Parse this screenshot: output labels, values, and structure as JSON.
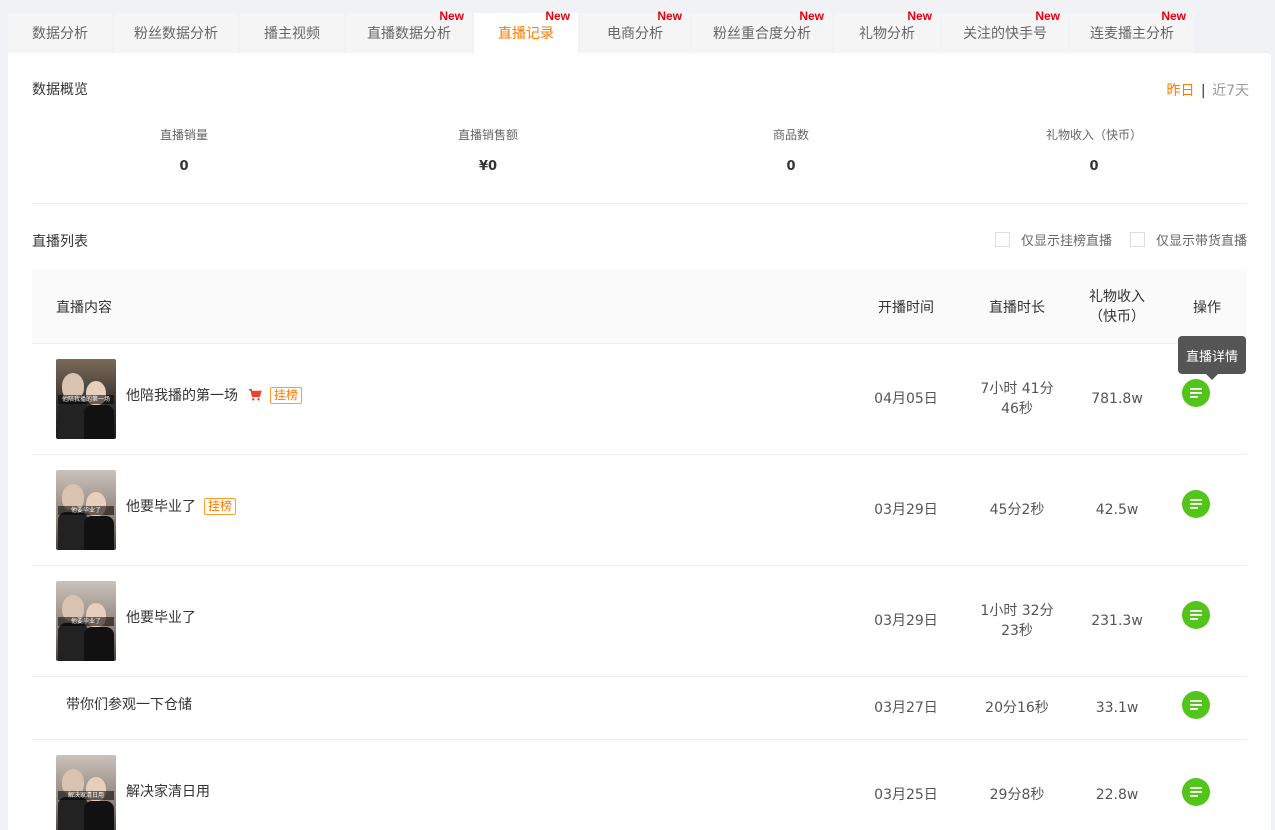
{
  "tabs": [
    {
      "label": "数据分析",
      "new": ""
    },
    {
      "label": "粉丝数据分析",
      "new": ""
    },
    {
      "label": "播主视频",
      "new": ""
    },
    {
      "label": "直播数据分析",
      "new": "New"
    },
    {
      "label": "直播记录",
      "new": "New"
    },
    {
      "label": "电商分析",
      "new": "New"
    },
    {
      "label": "粉丝重合度分析",
      "new": "New"
    },
    {
      "label": "礼物分析",
      "new": "New"
    },
    {
      "label": "关注的快手号",
      "new": "New"
    },
    {
      "label": "连麦播主分析",
      "new": "New"
    }
  ],
  "overview": {
    "title": "数据概览",
    "period_yesterday": "昨日",
    "period_sep": "|",
    "period_7days": "近7天",
    "stats": [
      {
        "label": "直播销量",
        "value": "0"
      },
      {
        "label": "直播销售额",
        "value": "¥0"
      },
      {
        "label": "商品数",
        "value": "0"
      },
      {
        "label": "礼物收入（快币）",
        "value": "0"
      }
    ]
  },
  "live_list": {
    "title": "直播列表",
    "filter_rank": "仅显示挂榜直播",
    "filter_goods": "仅显示带货直播",
    "headers": {
      "content": "直播内容",
      "start_time": "开播时间",
      "duration": "直播时长",
      "gift_line1": "礼物收入",
      "gift_line2": "（快币）",
      "action": "操作"
    },
    "tooltip": "直播详情",
    "rows": [
      {
        "title": "他陪我播的第一场",
        "tag": "挂榜",
        "thumb_caption": "他陪我播的第一场",
        "date": "04月05日",
        "duration_1": "7小时 41分",
        "duration_2": "46秒",
        "gift": "781.8w"
      },
      {
        "title": "他要毕业了",
        "tag": "挂榜",
        "thumb_caption": "他要毕业了",
        "date": "03月29日",
        "duration_1": "45分2秒",
        "duration_2": "",
        "gift": "42.5w"
      },
      {
        "title": "他要毕业了",
        "tag": "",
        "thumb_caption": "他要毕业了",
        "date": "03月29日",
        "duration_1": "1小时 32分",
        "duration_2": "23秒",
        "gift": "231.3w"
      },
      {
        "title": "带你们参观一下仓储",
        "tag": "",
        "thumb_caption": "",
        "date": "03月27日",
        "duration_1": "20分16秒",
        "duration_2": "",
        "gift": "33.1w"
      },
      {
        "title": "解决家清日用",
        "tag": "",
        "thumb_caption": "解决家清日用",
        "date": "03月25日",
        "duration_1": "29分8秒",
        "duration_2": "",
        "gift": "22.8w"
      }
    ]
  },
  "colors": {
    "accent": "#ff7a00",
    "new_badge": "#e60012",
    "action_button": "#52c41a"
  }
}
